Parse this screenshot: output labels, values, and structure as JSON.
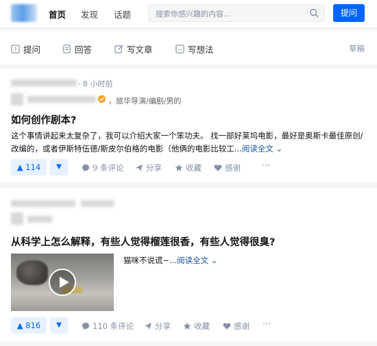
{
  "nav": {
    "home": "首页",
    "discover": "发现",
    "topics": "话题"
  },
  "search": {
    "placeholder": "搜索你感兴趣的内容..."
  },
  "header": {
    "ask_label": "提问"
  },
  "creator": {
    "ask": "提问",
    "answer": "回答",
    "article": "写文章",
    "idea": "写想法",
    "drafts": "草稿"
  },
  "feed": [
    {
      "time": "· 8 小时前",
      "author_bio": "，旅华导演/编剧/男的",
      "title": "如何创作剧本?",
      "excerpt": "这个事情讲起来太复杂了，我可以介绍大家一个笨功夫。 找一部好莱坞电影，最好是奥斯卡最佳原创/改编的，或者伊斯特伍德/斯皮尔伯格的电影（他俩的电影比较工...",
      "read_more": "阅读全文 ⌄",
      "upvotes": "▲ 114",
      "downvote": "▼",
      "comments": "9 条评论",
      "share": "分享",
      "collect": "收藏",
      "thanks": "感谢",
      "more": "···"
    },
    {
      "title": "从科学上怎么解释，有些人觉得榴莲很香，有些人觉得很臭?",
      "excerpt": "猫咪不说谎~...",
      "read_more": "阅读全文 ⌄",
      "upvotes": "▲ 816",
      "downvote": "▼",
      "comments": "110 条评论",
      "share": "分享",
      "collect": "收藏",
      "thanks": "感谢",
      "more": "···"
    }
  ],
  "colors": {
    "brand": "#0066ff",
    "link": "#175199",
    "muted": "#8590a6"
  }
}
